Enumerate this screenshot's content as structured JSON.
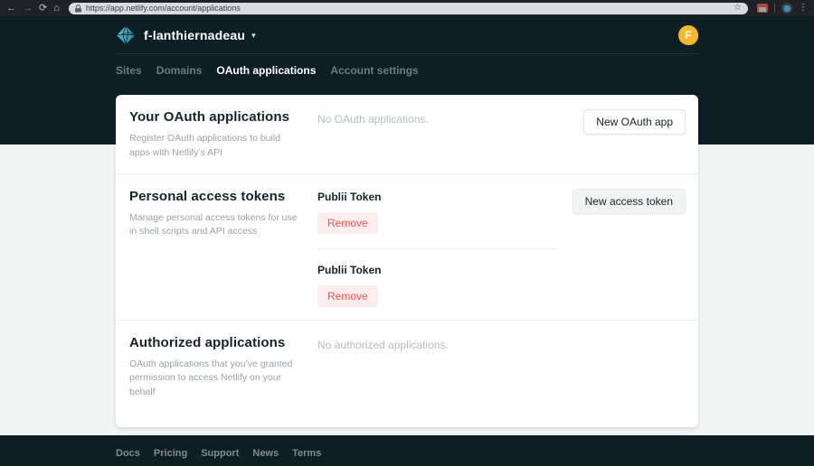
{
  "browser": {
    "url": "https://app.netlify.com/account/applications"
  },
  "header": {
    "account_name": "f-lanthiernadeau",
    "avatar_initial": "F",
    "nav": [
      {
        "label": "Sites"
      },
      {
        "label": "Domains"
      },
      {
        "label": "OAuth applications"
      },
      {
        "label": "Account settings"
      }
    ]
  },
  "sections": {
    "oauth": {
      "title": "Your OAuth applications",
      "description": "Register OAuth applications to build apps with Netlify’s API",
      "empty_text": "No OAuth applications.",
      "button_label": "New OAuth app"
    },
    "tokens": {
      "title": "Personal access tokens",
      "description": "Manage personal access tokens for use in shell scripts and API access",
      "button_label": "New access token",
      "items": [
        {
          "name": "Publii Token",
          "action": "Remove"
        },
        {
          "name": "Publii Token",
          "action": "Remove"
        }
      ]
    },
    "authorized": {
      "title": "Authorized applications",
      "description": "OAuth applications that you’ve granted permission to access Netlify on your behalf",
      "empty_text": "No authorized applications."
    }
  },
  "footer": {
    "links": [
      "Docs",
      "Pricing",
      "Support",
      "News",
      "Terms"
    ]
  },
  "colors": {
    "header_bg": "#0d1e25",
    "logo_teal": "#3fa3b8",
    "avatar_yellow": "#f7b72c",
    "remove_red": "#e9564f",
    "remove_bg": "#fdeeed",
    "page_bg": "#f3f5f5"
  }
}
